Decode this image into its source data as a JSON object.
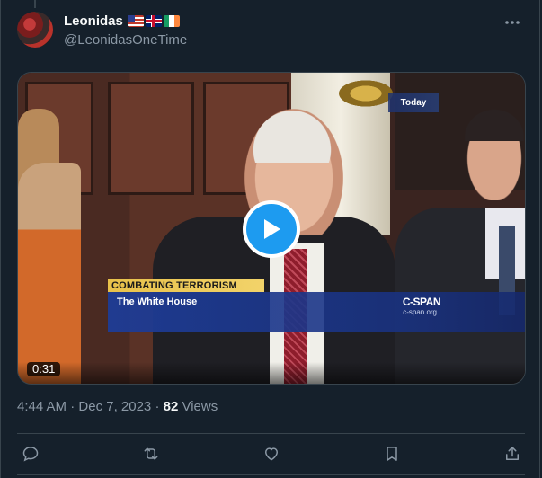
{
  "user": {
    "display_name": "Leonidas",
    "handle": "@LeonidasOneTime",
    "flags": [
      "us-flag-icon",
      "uk-flag-icon",
      "ireland-flag-icon"
    ]
  },
  "media": {
    "type": "video",
    "duration": "0:31",
    "overlay": {
      "network_bug": "Today",
      "topic": "COMBATING TERRORISM",
      "location": "The White House",
      "network_logo": "C-SPAN",
      "network_url": "c-span.org"
    }
  },
  "meta": {
    "time": "4:44 AM",
    "separator": "·",
    "date": "Dec 7, 2023",
    "views_count": "82",
    "views_label": "Views"
  },
  "actions": [
    "reply-icon",
    "repost-icon",
    "like-icon",
    "bookmark-icon",
    "share-icon"
  ],
  "colors": {
    "background": "#15202b",
    "border": "#38444d",
    "secondary_text": "#8b98a5",
    "accent": "#1d9bf0"
  }
}
